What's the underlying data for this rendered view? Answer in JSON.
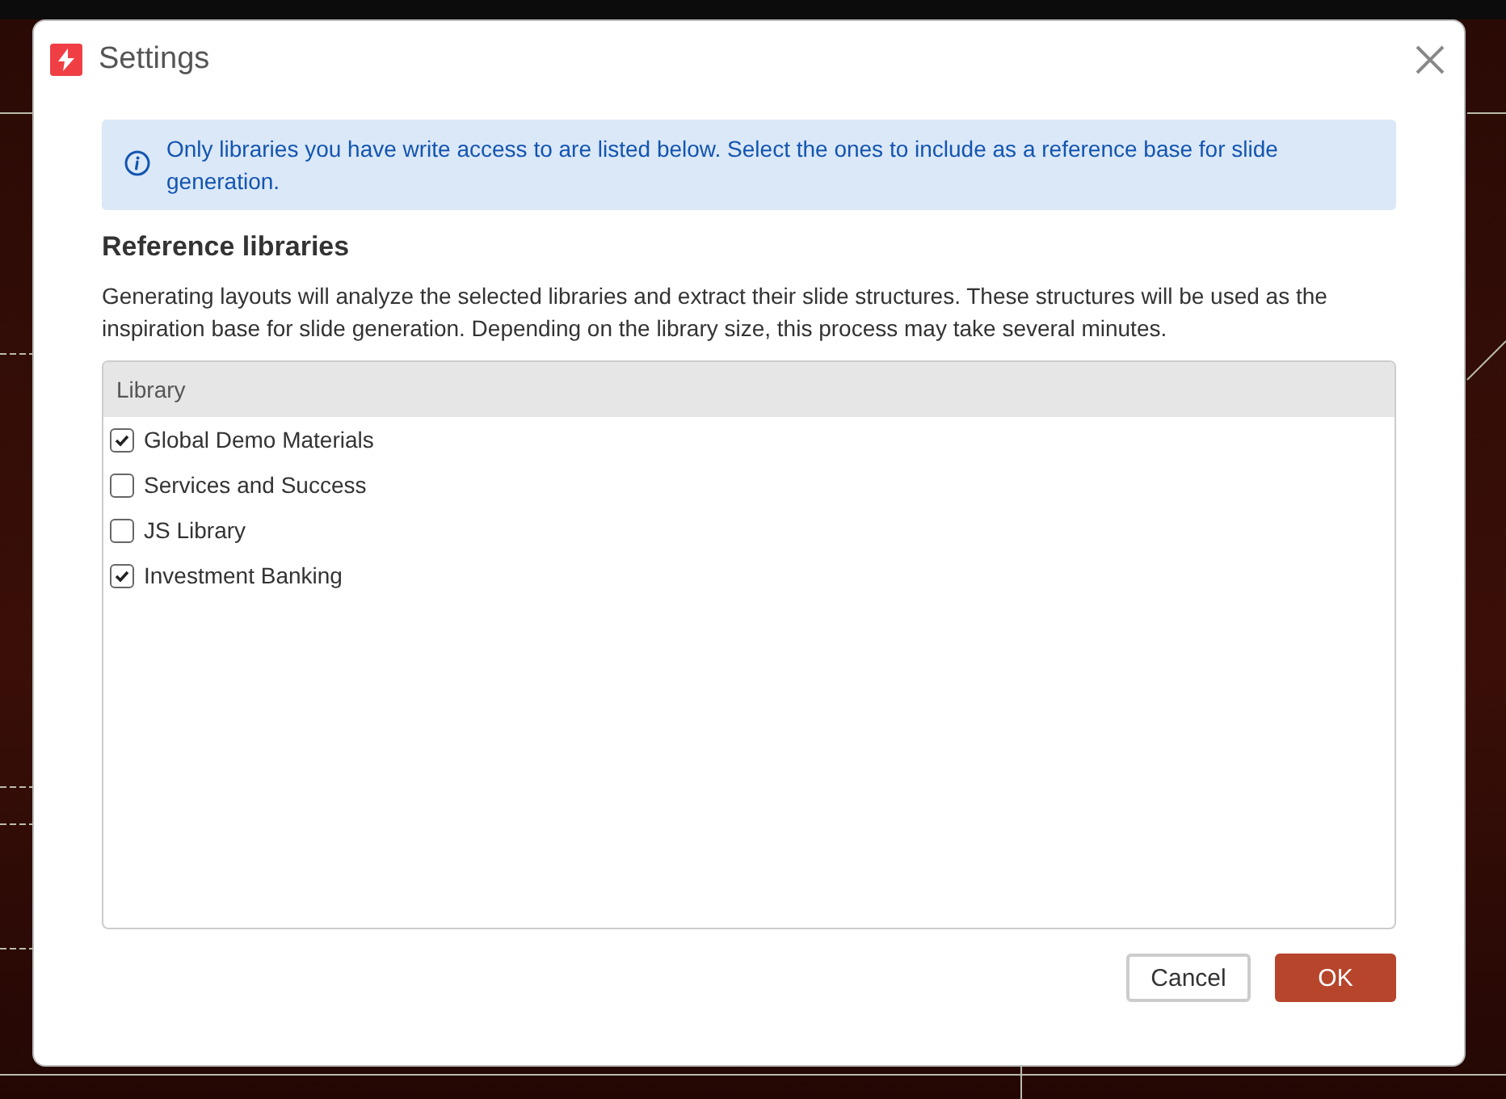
{
  "window": {
    "title": "Settings"
  },
  "info": {
    "text": "Only libraries you have write access to are listed below. Select the ones to include as a reference base for slide generation."
  },
  "section": {
    "title": "Reference libraries",
    "description": "Generating layouts will analyze the selected libraries and extract their slide structures. These structures will be used as the inspiration base for slide generation. Depending on the library size, this process may take several minutes."
  },
  "table": {
    "columns": [
      "Library"
    ],
    "rows": [
      {
        "label": "Global Demo Materials",
        "checked": true
      },
      {
        "label": "Services and Success",
        "checked": false
      },
      {
        "label": "JS Library",
        "checked": false
      },
      {
        "label": "Investment Banking",
        "checked": true
      }
    ]
  },
  "buttons": [
    {
      "label": "Cancel",
      "kind": "secondary"
    },
    {
      "label": "OK",
      "kind": "primary"
    }
  ]
}
